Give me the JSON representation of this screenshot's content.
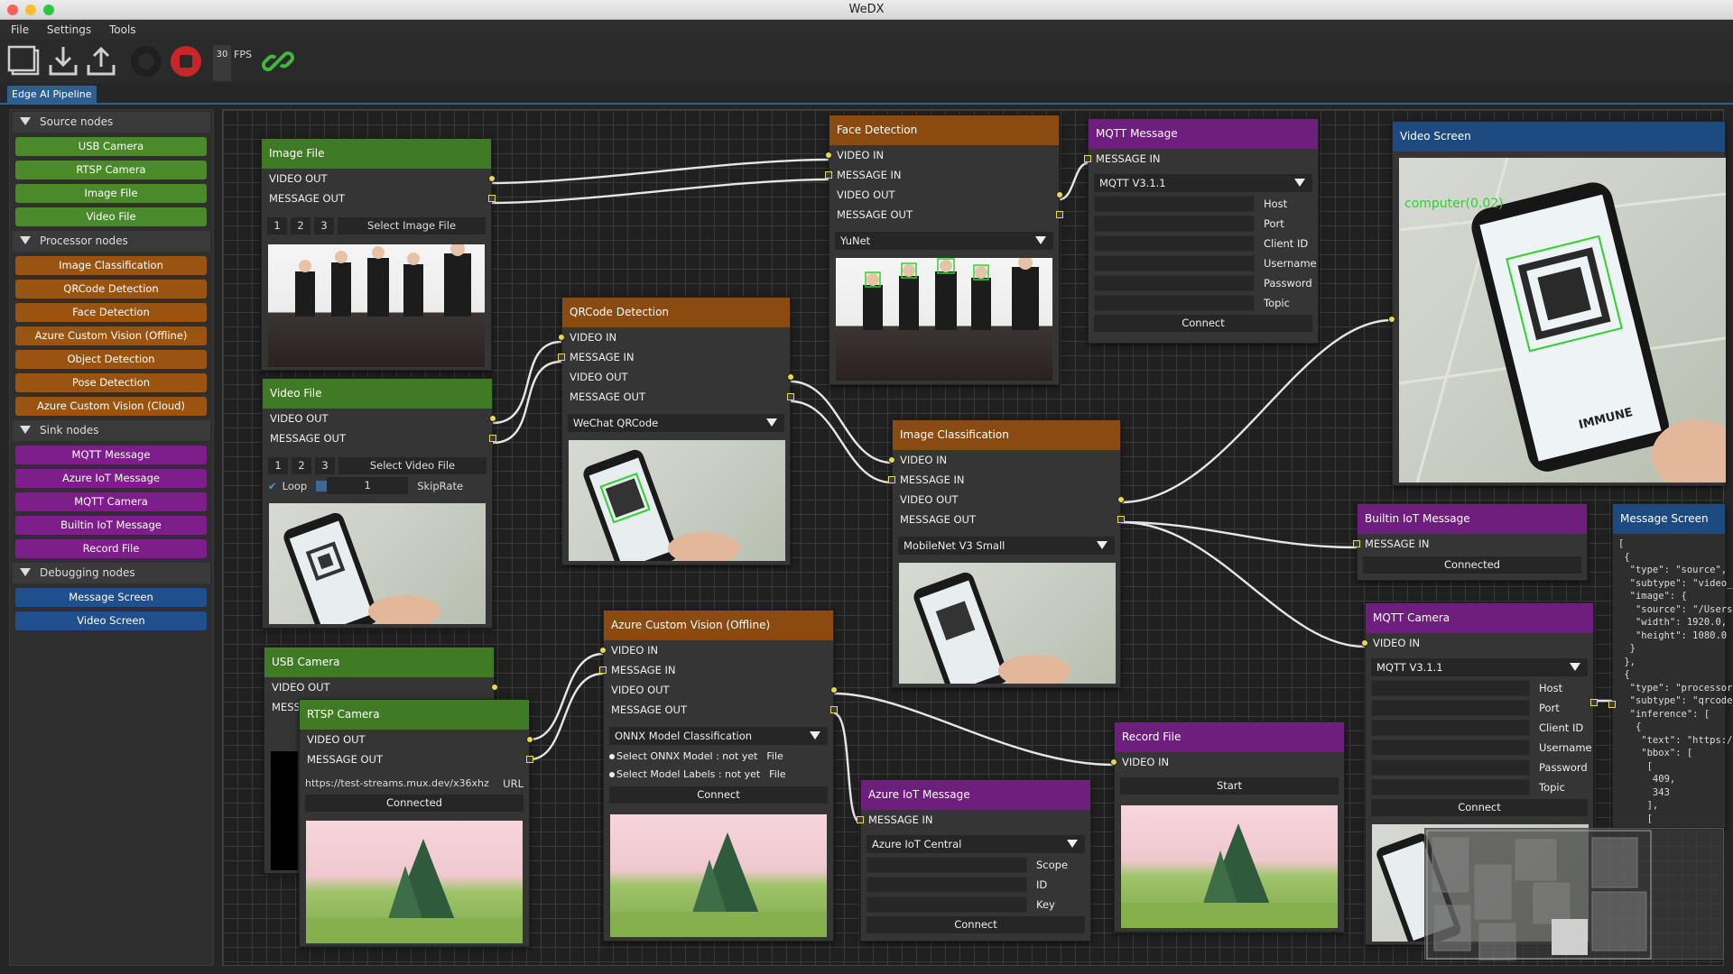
{
  "window": {
    "title": "WeDX"
  },
  "menu": [
    "File",
    "Settings",
    "Tools"
  ],
  "toolbar": {
    "fps_value": "30",
    "fps_label": "FPS"
  },
  "tab": {
    "label": "Edge AI Pipeline"
  },
  "sidebar": {
    "sections": {
      "source": "Source nodes",
      "processor": "Processor nodes",
      "sink": "Sink nodes",
      "debugging": "Debugging nodes"
    },
    "source_items": [
      "USB Camera",
      "RTSP Camera",
      "Image File",
      "Video File"
    ],
    "processor_items": [
      "Image Classification",
      "QRCode Detection",
      "Face Detection",
      "Azure Custom Vision (Offline)",
      "Object Detection",
      "Pose Detection",
      "Azure Custom Vision (Cloud)"
    ],
    "sink_items": [
      "MQTT Message",
      "Azure IoT Message",
      "MQTT Camera",
      "Builtin IoT Message",
      "Record File"
    ],
    "debugging_items": [
      "Message Screen",
      "Video Screen"
    ]
  },
  "ports": {
    "video_out": "VIDEO OUT",
    "message_out": "MESSAGE OUT",
    "video_in": "VIDEO IN",
    "message_in": "MESSAGE IN",
    "mess_trunc": "MESS"
  },
  "nodes": {
    "image_file": {
      "title": "Image File",
      "n1": "1",
      "n2": "2",
      "n3": "3",
      "select": "Select Image File"
    },
    "video_file": {
      "title": "Video File",
      "n1": "1",
      "n2": "2",
      "n3": "3",
      "select": "Select Video File",
      "loop": "Loop",
      "skip_value": "1",
      "skip_label": "SkipRate"
    },
    "usb_camera": {
      "title": "USB Camera"
    },
    "rtsp_camera": {
      "title": "RTSP Camera",
      "url": "https://test-streams.mux.dev/x36xhz",
      "url_label": "URL",
      "status": "Connected"
    },
    "face_detection": {
      "title": "Face Detection",
      "model": "YuNet"
    },
    "qrcode_detection": {
      "title": "QRCode Detection",
      "model": "WeChat QRCode"
    },
    "image_classification": {
      "title": "Image Classification",
      "model": "MobileNet V3 Small"
    },
    "azure_cv_offline": {
      "title": "Azure Custom Vision (Offline)",
      "model": "ONNX Model Classification",
      "sel_model": "Select ONNX Model : not yet",
      "sel_labels": "Select Model Labels : not yet",
      "file": "File",
      "connect": "Connect"
    },
    "mqtt_message": {
      "title": "MQTT Message",
      "version": "MQTT V3.1.1",
      "host": "Host",
      "port": "Port",
      "client_id": "Client ID",
      "username": "Username",
      "password": "Password",
      "topic": "Topic",
      "connect": "Connect"
    },
    "video_screen": {
      "title": "Video Screen",
      "overlay1": "computer(0.02)",
      "phone_text": "IMMUNE"
    },
    "builtin_iot": {
      "title": "Builtin IoT Message",
      "status": "Connected"
    },
    "message_screen": {
      "title": "Message Screen",
      "content": "[\n {\n  \"type\": \"source\",\n  \"subtype\": \"video_fil\n  \"image\": {\n   \"source\": \"/Users/mc\n   \"width\": 1920.0,\n   \"height\": 1080.0\n  }\n },\n {\n  \"type\": \"processor\",\n  \"subtype\": \"qrcode_c\n  \"inference\": [\n   {\n    \"text\": \"https://ec.e\n    \"bbox\": [\n     [\n      409,\n      343\n     ],\n     ["
    },
    "mqtt_camera": {
      "title": "MQTT Camera",
      "version": "MQTT V3.1.1",
      "host": "Host",
      "port": "Port",
      "client_id": "Client ID",
      "username": "Username",
      "password": "Password",
      "topic": "Topic",
      "connect": "Connect"
    },
    "record_file": {
      "title": "Record File",
      "start": "Start"
    },
    "azure_iot": {
      "title": "Azure IoT Message",
      "service": "Azure IoT Central",
      "scope": "Scope",
      "id": "ID",
      "key": "Key",
      "connect": "Connect"
    }
  },
  "colors": {
    "source": "#4a8a2a",
    "processor": "#9a5412",
    "sink": "#7d1e8a",
    "debugging": "#1f4f8c",
    "port": "#e8d84a"
  }
}
